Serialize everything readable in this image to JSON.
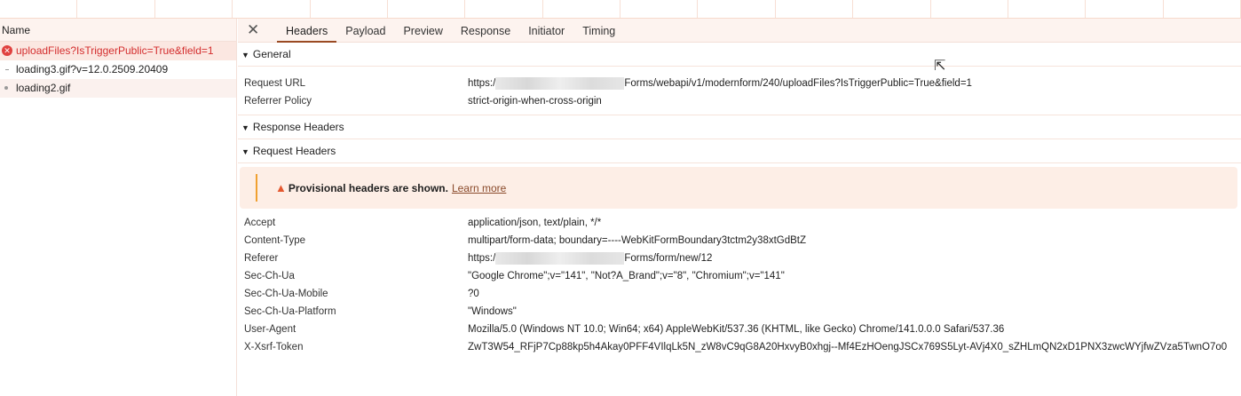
{
  "requests_panel": {
    "header": "Name",
    "items": [
      {
        "name": "uploadFiles?IsTriggerPublic=True&field=1",
        "status": "error"
      },
      {
        "name": "loading3.gif?v=12.0.2509.20409"
      },
      {
        "name": "loading2.gif"
      }
    ]
  },
  "tabs": [
    "Headers",
    "Payload",
    "Preview",
    "Response",
    "Initiator",
    "Timing"
  ],
  "active_tab": "Headers",
  "general": {
    "title": "General",
    "request_url_label": "Request URL",
    "request_url_prefix": "https:/",
    "request_url_suffix": "Forms/webapi/v1/modernform/240/uploadFiles?IsTriggerPublic=True&field=1",
    "referrer_policy_label": "Referrer Policy",
    "referrer_policy": "strict-origin-when-cross-origin"
  },
  "response_headers": {
    "title": "Response Headers"
  },
  "request_headers": {
    "title": "Request Headers",
    "warning": "Provisional headers are shown.",
    "learn_more": "Learn more",
    "rows": [
      {
        "k": "Accept",
        "v": "application/json, text/plain, */*"
      },
      {
        "k": "Content-Type",
        "v": "multipart/form-data; boundary=----WebKitFormBoundary3tctm2y38xtGdBtZ"
      },
      {
        "k": "Referer",
        "v_prefix": "https:/",
        "v": "Forms/form/new/12"
      },
      {
        "k": "Sec-Ch-Ua",
        "v": "\"Google Chrome\";v=\"141\", \"Not?A_Brand\";v=\"8\", \"Chromium\";v=\"141\""
      },
      {
        "k": "Sec-Ch-Ua-Mobile",
        "v": "?0"
      },
      {
        "k": "Sec-Ch-Ua-Platform",
        "v": "\"Windows\""
      },
      {
        "k": "User-Agent",
        "v": "Mozilla/5.0 (Windows NT 10.0; Win64; x64) AppleWebKit/537.36 (KHTML, like Gecko) Chrome/141.0.0.0 Safari/537.36"
      },
      {
        "k": "X-Xsrf-Token",
        "v": "ZwT3W54_RFjP7Cp88kp5h4Akay0PFF4VIlqLk5N_zW8vC9qG8A20HxvyB0xhgj--Mf4EzHOengJSCx769S5Lyt-AVj4X0_sZHLmQN2xD1PNX3zwcWYjfwZVza5TwnO7o0"
      }
    ]
  }
}
